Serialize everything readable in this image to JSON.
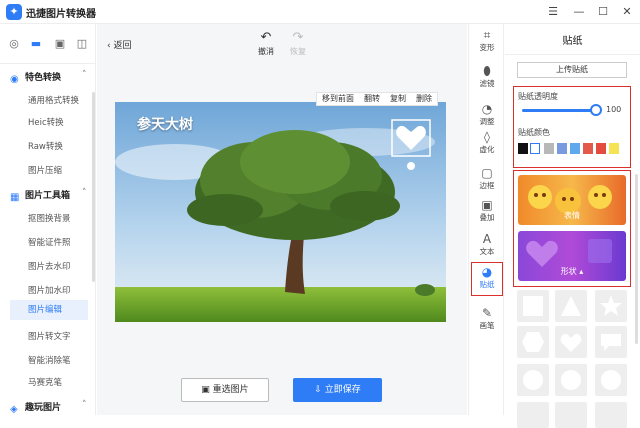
{
  "app": {
    "title": "迅捷图片转换器",
    "logo_icon": "app-logo-icon"
  },
  "window": {
    "menu": "☰",
    "minimize": "—",
    "maximize": "☐",
    "close": "✕"
  },
  "nav": {
    "icons": [
      "convert-icon",
      "image-tools-icon",
      "photo-icon",
      "layers-icon"
    ],
    "section1": "特色转换",
    "section1_items": [
      "通用格式转换",
      "Heic转换",
      "Raw转换",
      "图片压缩"
    ],
    "section2": "图片工具箱",
    "section2_items": [
      "抠图换背景",
      "智能证件照",
      "图片去水印",
      "图片加水印",
      "图片编辑",
      "图片转文字",
      "智能消除笔",
      "马赛克笔"
    ],
    "section3": "趣玩图片"
  },
  "toolbar": {
    "back": "返回",
    "undo": "撤消",
    "redo": "恢复"
  },
  "context_menu": [
    "移到前面",
    "翻转",
    "复制",
    "删除"
  ],
  "photo_text": "参天大树",
  "actions": {
    "reselect": "重选图片",
    "save": "立即保存"
  },
  "tools": [
    {
      "label": "变形",
      "icon": "crop-icon"
    },
    {
      "label": "滤镜",
      "icon": "filter-icon"
    },
    {
      "label": "调整",
      "icon": "adjust-icon"
    },
    {
      "label": "虚化",
      "icon": "blur-icon"
    },
    {
      "label": "边框",
      "icon": "frame-icon"
    },
    {
      "label": "叠加",
      "icon": "overlay-icon"
    },
    {
      "label": "文本",
      "icon": "text-icon"
    },
    {
      "label": "贴纸",
      "icon": "sticker-icon"
    },
    {
      "label": "画笔",
      "icon": "brush-icon"
    }
  ],
  "panel": {
    "title": "贴纸",
    "upload": "上传贴纸",
    "opacity_label": "贴纸透明度",
    "opacity_value": "100",
    "color_label": "贴纸颜色",
    "colors": [
      "#111111",
      "#ffffff",
      "#b8b8b8",
      "#7a9ae0",
      "#5fa8ee",
      "#e45a4a",
      "#e24b3d",
      "#f5e356"
    ],
    "categories": [
      "表情",
      "形状"
    ]
  },
  "colors": {
    "accent": "#2e7cf6",
    "highlight": "#d9302c"
  }
}
